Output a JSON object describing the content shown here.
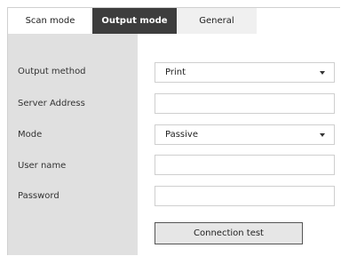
{
  "tabs": [
    {
      "label": "Scan mode"
    },
    {
      "label": "Output mode"
    },
    {
      "label": "General"
    }
  ],
  "active_tab": "Output mode",
  "form": {
    "output_method": {
      "label": "Output method",
      "value": "Print"
    },
    "server_address": {
      "label": "Server Address",
      "value": ""
    },
    "mode": {
      "label": "Mode",
      "value": "Passive"
    },
    "user_name": {
      "label": "User name",
      "value": ""
    },
    "password": {
      "label": "Password",
      "value": ""
    }
  },
  "connection_test_label": "Connection test",
  "icons": {
    "dropdown": "chevron-down-icon"
  },
  "colors": {
    "active_tab_bg": "#3d3d3d",
    "sidebar_bg": "#e0e0e0",
    "general_tab_bg": "#f0f0f0"
  }
}
